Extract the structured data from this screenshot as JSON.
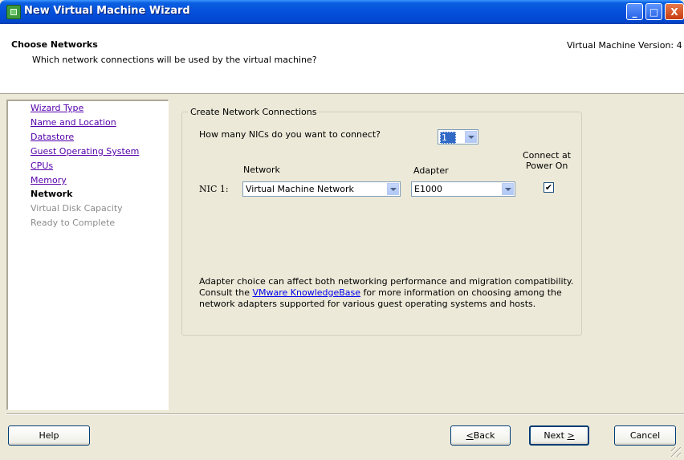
{
  "window": {
    "title": "New Virtual Machine Wizard",
    "controls": {
      "minimize": "_",
      "maximize": "□",
      "close": "X"
    }
  },
  "header": {
    "title": "Choose Networks",
    "subtitle": "Which network connections will be used by the virtual machine?",
    "vm_version": "Virtual Machine Version: 4"
  },
  "nav": {
    "items": [
      {
        "label": "Wizard Type",
        "state": "link"
      },
      {
        "label": "Name and Location",
        "state": "link"
      },
      {
        "label": "Datastore",
        "state": "link"
      },
      {
        "label": "Guest Operating System",
        "state": "link"
      },
      {
        "label": "CPUs",
        "state": "link"
      },
      {
        "label": "Memory",
        "state": "link"
      },
      {
        "label": "Network",
        "state": "current"
      },
      {
        "label": "Virtual Disk Capacity",
        "state": "disabled"
      },
      {
        "label": "Ready to Complete",
        "state": "disabled"
      }
    ]
  },
  "group": {
    "title": "Create Network Connections",
    "nic_question": "How many NICs do you want to connect?",
    "nic_count": "1",
    "col_network": "Network",
    "col_adapter": "Adapter",
    "col_connect_line1": "Connect at",
    "col_connect_line2": "Power On",
    "nic_row": {
      "label": "NIC 1:",
      "network": "Virtual Machine Network",
      "adapter": "E1000",
      "connect_checked": true
    },
    "info_before": "Adapter choice can affect both networking performance and migration compatibility. Consult the ",
    "info_link": "VMware KnowledgeBase",
    "info_after": " for more information on choosing among the network adapters supported for various guest operating systems and hosts."
  },
  "buttons": {
    "help": "Help",
    "back_mnemonic": "<",
    "back_prefix": "",
    "back_rest": "Back",
    "next_label": "Next ",
    "next_mnemonic": ">",
    "cancel": "Cancel"
  },
  "icons": {
    "app": "vm-wizard-icon",
    "checkbox_mark": "✔"
  }
}
